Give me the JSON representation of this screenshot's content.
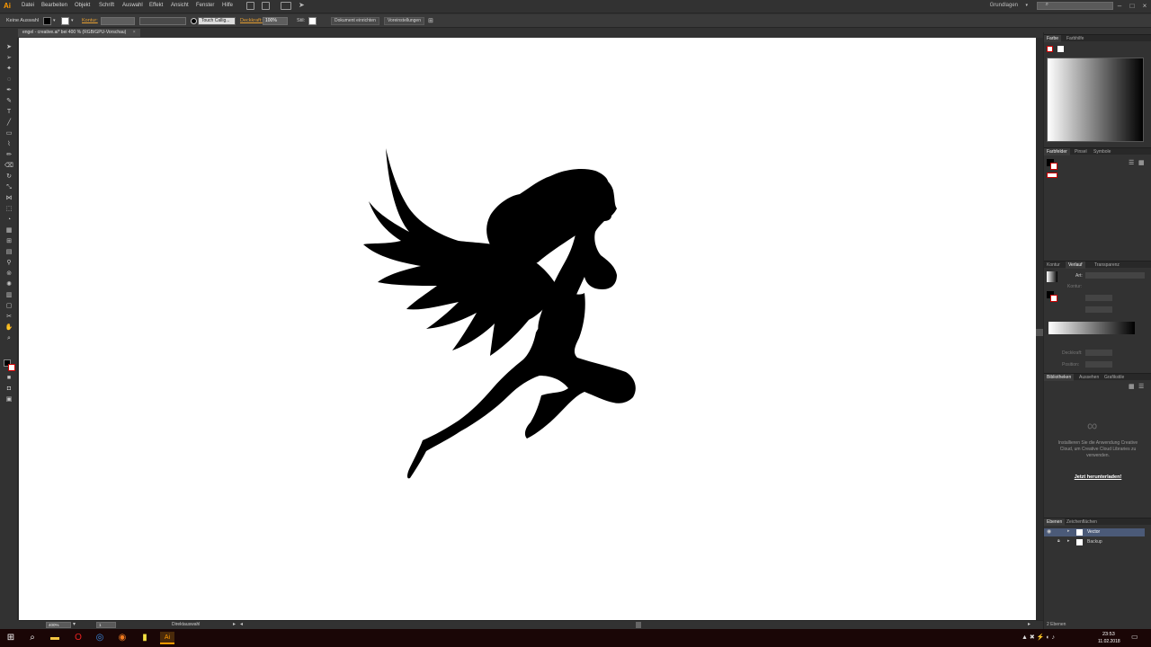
{
  "app": {
    "logo": "Ai"
  },
  "menu": [
    "Datei",
    "Bearbeiten",
    "Objekt",
    "Schrift",
    "Auswahl",
    "Effekt",
    "Ansicht",
    "Fenster",
    "Hilfe"
  ],
  "workspace": "Grundlagen",
  "control_bar": {
    "selection": "Keine Auswahl",
    "stroke_label": "Kontur:",
    "brush": "Touch Callig...",
    "opacity_label": "Deckkraft:",
    "opacity_value": "100%",
    "style_label": "Stil:",
    "btn_document": "Dokument einrichten",
    "btn_prefs": "Voreinstellungen"
  },
  "document_tab": "engel - creative.ai* bei 400 % (RGB/GPU-Vorschau)",
  "status": {
    "zoom": "400%",
    "page": "1",
    "tool": "Direktauswahl"
  },
  "panels": {
    "color_tabs": [
      "Farbe",
      "Farbhilfe"
    ],
    "swatch_tabs": [
      "Farbfelder",
      "Pinsel",
      "Symbole"
    ],
    "gradient_tabs": [
      "Kontur",
      "Verlauf",
      "Transparenz"
    ],
    "gradient": {
      "type_label": "Art:",
      "stroke_label": "Kontur:",
      "opacity_label": "Deckkraft:",
      "position_label": "Position:"
    },
    "libraries_tabs": [
      "Bibliotheken",
      "Aussehen",
      "Grafikstile"
    ],
    "libraries_message": "Installieren Sie die Anwendung Creative Cloud, um Creative Cloud Libraries zu verwenden.",
    "libraries_link": "Jetzt herunterladen!",
    "layers_tabs": [
      "Ebenen",
      "Zeichenflächen"
    ],
    "layers": [
      {
        "name": "Vector"
      },
      {
        "name": "Backup"
      }
    ],
    "layers_count": "2 Ebenen"
  },
  "taskbar": {
    "time": "23:53",
    "date": "11.02.2018"
  },
  "colors": {
    "accent": "#ff9a00",
    "canvas": "#ffffff",
    "ui": "#323232",
    "selected_layer": "#4b5a78"
  }
}
